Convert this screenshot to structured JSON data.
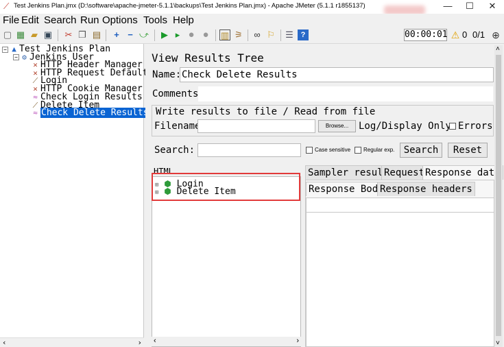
{
  "window": {
    "title": "Test Jenkins Plan.jmx (D:\\software\\apache-jmeter-5.1.1\\backups\\Test Jenkins Plan.jmx) - Apache JMeter (5.1.1 r1855137)",
    "minimize": "—",
    "maximize": "☐",
    "close": "✕"
  },
  "menu": [
    "File",
    "Edit",
    "Search",
    "Run",
    "Options",
    "Tools",
    "Help"
  ],
  "toolbar": {
    "timer": "00:00:01",
    "warning_count": "0",
    "threads": "0/1"
  },
  "tree": {
    "nodes": [
      {
        "label": "Test Jenkins Plan",
        "icon": "test-plan-icon"
      },
      {
        "label": "Jenkins User",
        "icon": "thread-group-icon"
      },
      {
        "label": "HTTP Header Manager",
        "icon": "config-icon"
      },
      {
        "label": "HTTP Request Default",
        "icon": "config-icon"
      },
      {
        "label": "Login",
        "icon": "sampler-icon"
      },
      {
        "label": "HTTP Cookie Manager",
        "icon": "config-icon"
      },
      {
        "label": "Check Login Results",
        "icon": "listener-icon"
      },
      {
        "label": "Delete Item",
        "icon": "sampler-icon"
      },
      {
        "label": "Check Delete Results",
        "icon": "listener-icon"
      }
    ]
  },
  "panel": {
    "title": "View Results Tree",
    "name_label": "Name:",
    "name_value": "Check Delete Results",
    "comments_label": "Comments:",
    "comments_value": "",
    "file_group_title": "Write results to file / Read from file",
    "filename_label": "Filename",
    "filename_value": "",
    "browse_label": "Browse...",
    "log_display_label": "Log/Display Only:",
    "errors_label": "Errors",
    "search_label": "Search:",
    "search_value": "",
    "case_sensitive_label": "Case sensitive",
    "regular_exp_label": "Regular exp.",
    "search_button": "Search",
    "reset_button": "Reset",
    "renderer": "HTML",
    "results": [
      {
        "label": "Login",
        "status": "success"
      },
      {
        "label": "Delete Item",
        "status": "success"
      }
    ],
    "tabs": [
      "Sampler result",
      "Request",
      "Response data"
    ],
    "active_tab": "Response data",
    "subtabs": [
      "Response Body",
      "Response headers"
    ],
    "active_subtab": "Response Body"
  },
  "colors": {
    "selection": "#0a64d3",
    "highlight_frame": "#e23a3a",
    "success_shield": "#2e9b3a"
  }
}
